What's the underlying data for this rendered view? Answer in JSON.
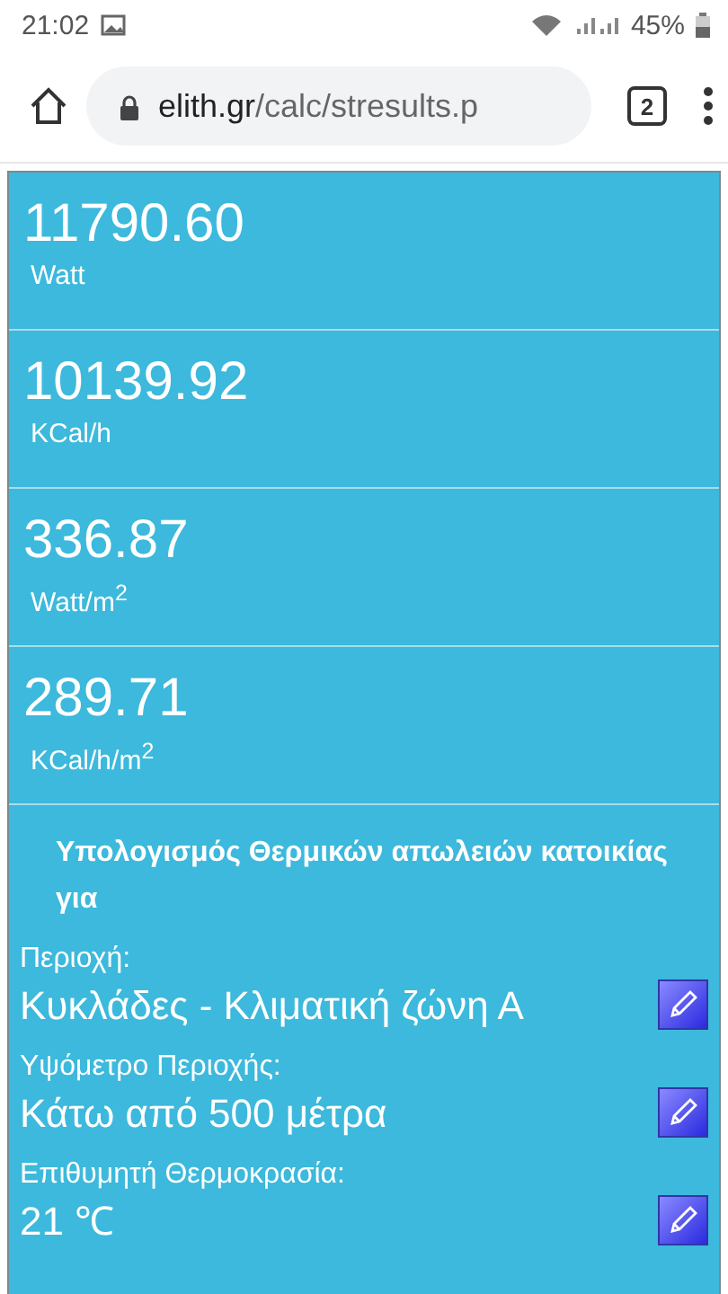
{
  "status_bar": {
    "time": "21:02",
    "battery": "45%"
  },
  "browser": {
    "url_host": "elith.gr",
    "url_path": "/calc/stresults.p",
    "tab_count": "2"
  },
  "results": [
    {
      "value": "11790.60",
      "unit": "Watt"
    },
    {
      "value": "10139.92",
      "unit": "KCal/h"
    },
    {
      "value": "336.87",
      "unit": "Watt/m$^{2}$"
    },
    {
      "value": "289.71",
      "unit": "KCal/h/m$^{2}$"
    }
  ],
  "section_title": "Υπολογισμός Θερμικών απωλειών κατοικίας για",
  "parameters": [
    {
      "label": "Περιοχή:",
      "value": "Κυκλάδες - Κλιματική ζώνη Α"
    },
    {
      "label": "Υψόμετρο Περιοχής:",
      "value": "Κάτω από 500 μέτρα"
    },
    {
      "label": "Επιθυμητή Θερμοκρασία:",
      "value": "21 ℃"
    }
  ]
}
